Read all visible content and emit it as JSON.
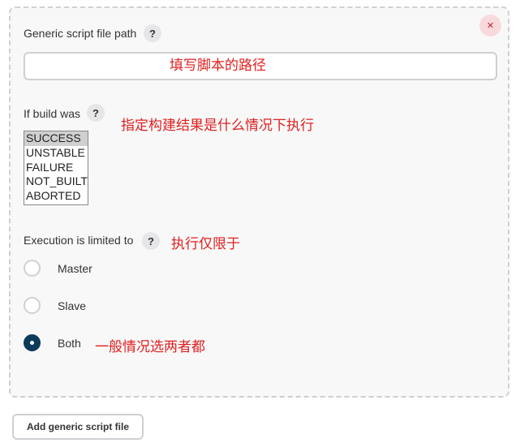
{
  "panel": {
    "close_glyph": "×",
    "script_path": {
      "label": "Generic script file path",
      "help": "?",
      "value": "",
      "annotation": "填写脚本的路径"
    },
    "build_status": {
      "label": "If build was",
      "help": "?",
      "annotation": "指定构建结果是什么情况下执行",
      "options": [
        "SUCCESS",
        "UNSTABLE",
        "FAILURE",
        "NOT_BUILT",
        "ABORTED"
      ],
      "selected": "SUCCESS"
    },
    "execution": {
      "label": "Execution is limited to",
      "help": "?",
      "annotation": "执行仅限于",
      "options": [
        "Master",
        "Slave",
        "Both"
      ],
      "selected": "Both",
      "both_annotation": "一般情况选两者都"
    }
  },
  "footer": {
    "add_button_label": "Add generic script file"
  },
  "colors": {
    "annotation": "#e02020",
    "radio_checked": "#0b3a5a",
    "close_icon": "#c1232f"
  }
}
